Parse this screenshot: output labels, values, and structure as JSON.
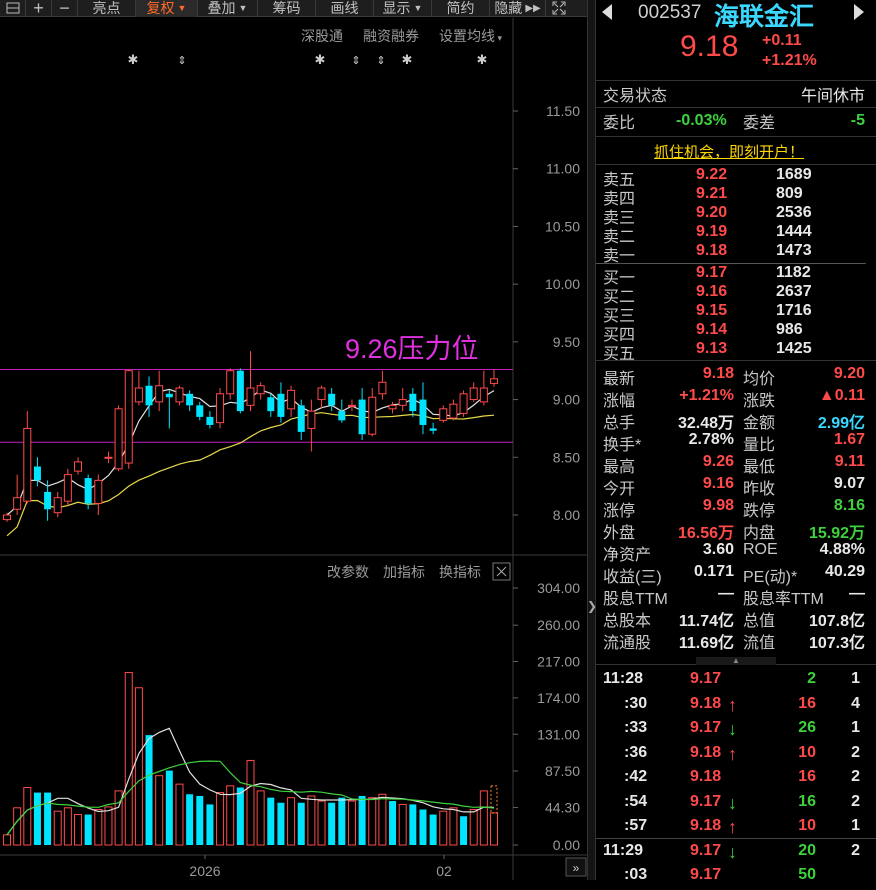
{
  "toolbar": {
    "items": [
      "亮点",
      "复权",
      "叠加",
      "筹码",
      "画线",
      "显示",
      "简约",
      "隐藏"
    ]
  },
  "subbar": {
    "items": [
      "深股通",
      "融资融券",
      "设置均线"
    ]
  },
  "chart": {
    "annotation": "9.26压力位",
    "price_ticks": [
      "11.50",
      "11.00",
      "10.50",
      "10.00",
      "9.50",
      "9.00",
      "8.50",
      "8.00"
    ],
    "volume_ticks": [
      "304.00",
      "260.00",
      "217.00",
      "174.00",
      "131.00",
      "87.50",
      "44.30",
      "0.00"
    ],
    "indicator_buttons": [
      "改参数",
      "加指标",
      "换指标"
    ],
    "x_labels": [
      "2026",
      "02"
    ],
    "colors": {
      "up": "#ff4a4a",
      "down": "#00e5ff",
      "ma_white": "#e0e0e0",
      "ma_yellow": "#e6d84a",
      "ma_green": "#3ed13e",
      "level": "#c020c0",
      "annotation": "#e030e0"
    }
  },
  "chart_data": {
    "type": "candlestick",
    "title": "",
    "resistance": 9.26,
    "support": 8.63,
    "ylim": [
      7.8,
      11.75
    ],
    "volume_ylim": [
      0,
      304
    ],
    "candles": [
      {
        "o": 7.96,
        "c": 8.0,
        "h": 8.02,
        "l": 7.94
      },
      {
        "o": 8.05,
        "c": 8.15,
        "h": 8.35,
        "l": 8.0
      },
      {
        "o": 8.12,
        "c": 8.75,
        "h": 8.9,
        "l": 8.1
      },
      {
        "o": 8.42,
        "c": 8.3,
        "h": 8.5,
        "l": 8.25
      },
      {
        "o": 8.2,
        "c": 8.05,
        "h": 8.3,
        "l": 7.95
      },
      {
        "o": 8.02,
        "c": 8.15,
        "h": 8.2,
        "l": 7.98
      },
      {
        "o": 8.12,
        "c": 8.35,
        "h": 8.4,
        "l": 8.08
      },
      {
        "o": 8.38,
        "c": 8.46,
        "h": 8.5,
        "l": 8.35
      },
      {
        "o": 8.32,
        "c": 8.1,
        "h": 8.35,
        "l": 8.05
      },
      {
        "o": 8.1,
        "c": 8.3,
        "h": 8.35,
        "l": 8.0
      },
      {
        "o": 8.5,
        "c": 8.5,
        "h": 8.55,
        "l": 8.45
      },
      {
        "o": 8.4,
        "c": 8.92,
        "h": 8.95,
        "l": 8.38
      },
      {
        "o": 8.45,
        "c": 9.25,
        "h": 9.26,
        "l": 8.4
      },
      {
        "o": 8.98,
        "c": 9.1,
        "h": 9.25,
        "l": 8.95
      },
      {
        "o": 9.12,
        "c": 8.95,
        "h": 9.2,
        "l": 8.85
      },
      {
        "o": 8.98,
        "c": 9.12,
        "h": 9.25,
        "l": 8.9
      },
      {
        "o": 9.05,
        "c": 9.02,
        "h": 9.08,
        "l": 8.75
      },
      {
        "o": 8.98,
        "c": 9.1,
        "h": 9.12,
        "l": 8.95
      },
      {
        "o": 9.05,
        "c": 8.95,
        "h": 9.08,
        "l": 8.9
      },
      {
        "o": 8.95,
        "c": 8.85,
        "h": 8.98,
        "l": 8.82
      },
      {
        "o": 8.85,
        "c": 8.78,
        "h": 8.9,
        "l": 8.75
      },
      {
        "o": 8.8,
        "c": 9.05,
        "h": 9.1,
        "l": 8.75
      },
      {
        "o": 9.05,
        "c": 9.25,
        "h": 9.27,
        "l": 9.0
      },
      {
        "o": 9.25,
        "c": 8.9,
        "h": 9.27,
        "l": 8.88
      },
      {
        "o": 8.95,
        "c": 9.1,
        "h": 9.42,
        "l": 8.9
      },
      {
        "o": 9.05,
        "c": 9.12,
        "h": 9.15,
        "l": 9.0
      },
      {
        "o": 9.02,
        "c": 8.9,
        "h": 9.05,
        "l": 8.85
      },
      {
        "o": 9.05,
        "c": 8.85,
        "h": 9.15,
        "l": 8.8
      },
      {
        "o": 8.92,
        "c": 9.08,
        "h": 9.12,
        "l": 8.85
      },
      {
        "o": 8.95,
        "c": 8.72,
        "h": 9.0,
        "l": 8.65
      },
      {
        "o": 8.75,
        "c": 8.9,
        "h": 9.0,
        "l": 8.55
      },
      {
        "o": 9.0,
        "c": 9.1,
        "h": 9.12,
        "l": 8.92
      },
      {
        "o": 9.05,
        "c": 8.95,
        "h": 9.1,
        "l": 8.9
      },
      {
        "o": 8.9,
        "c": 8.82,
        "h": 9.0,
        "l": 8.8
      },
      {
        "o": 8.95,
        "c": 8.95,
        "h": 9.0,
        "l": 8.9
      },
      {
        "o": 9.0,
        "c": 8.7,
        "h": 9.1,
        "l": 8.65
      },
      {
        "o": 8.7,
        "c": 9.02,
        "h": 9.1,
        "l": 8.68
      },
      {
        "o": 9.05,
        "c": 9.15,
        "h": 9.25,
        "l": 9.0
      },
      {
        "o": 8.92,
        "c": 8.95,
        "h": 8.98,
        "l": 8.88
      },
      {
        "o": 8.95,
        "c": 9.0,
        "h": 9.1,
        "l": 8.9
      },
      {
        "o": 9.05,
        "c": 8.9,
        "h": 9.1,
        "l": 8.85
      },
      {
        "o": 9.0,
        "c": 8.78,
        "h": 9.15,
        "l": 8.7
      },
      {
        "o": 8.75,
        "c": 8.73,
        "h": 8.8,
        "l": 8.7
      },
      {
        "o": 8.82,
        "c": 8.92,
        "h": 8.95,
        "l": 8.8
      },
      {
        "o": 8.84,
        "c": 8.96,
        "h": 9.0,
        "l": 8.82
      },
      {
        "o": 8.88,
        "c": 9.05,
        "h": 9.08,
        "l": 8.85
      },
      {
        "o": 9.0,
        "c": 9.1,
        "h": 9.15,
        "l": 8.98
      },
      {
        "o": 8.98,
        "c": 9.1,
        "h": 9.25,
        "l": 8.95
      },
      {
        "o": 9.14,
        "c": 9.18,
        "h": 9.26,
        "l": 9.11
      }
    ],
    "volumes": [
      {
        "v": 12,
        "up": true
      },
      {
        "v": 44,
        "up": true
      },
      {
        "v": 68,
        "up": true
      },
      {
        "v": 62,
        "up": false
      },
      {
        "v": 62,
        "up": false
      },
      {
        "v": 40,
        "up": true
      },
      {
        "v": 44,
        "up": true
      },
      {
        "v": 36,
        "up": true
      },
      {
        "v": 36,
        "up": false
      },
      {
        "v": 42,
        "up": true
      },
      {
        "v": 45,
        "up": true
      },
      {
        "v": 64,
        "up": true
      },
      {
        "v": 204,
        "up": true
      },
      {
        "v": 186,
        "up": true
      },
      {
        "v": 130,
        "up": false
      },
      {
        "v": 82,
        "up": true
      },
      {
        "v": 88,
        "up": false
      },
      {
        "v": 72,
        "up": true
      },
      {
        "v": 60,
        "up": false
      },
      {
        "v": 58,
        "up": false
      },
      {
        "v": 48,
        "up": false
      },
      {
        "v": 62,
        "up": true
      },
      {
        "v": 70,
        "up": true
      },
      {
        "v": 68,
        "up": false
      },
      {
        "v": 100,
        "up": true
      },
      {
        "v": 64,
        "up": true
      },
      {
        "v": 56,
        "up": false
      },
      {
        "v": 50,
        "up": false
      },
      {
        "v": 56,
        "up": true
      },
      {
        "v": 50,
        "up": false
      },
      {
        "v": 58,
        "up": true
      },
      {
        "v": 52,
        "up": true
      },
      {
        "v": 50,
        "up": false
      },
      {
        "v": 56,
        "up": false
      },
      {
        "v": 52,
        "up": true
      },
      {
        "v": 58,
        "up": false
      },
      {
        "v": 56,
        "up": true
      },
      {
        "v": 60,
        "up": true
      },
      {
        "v": 52,
        "up": false
      },
      {
        "v": 48,
        "up": true
      },
      {
        "v": 48,
        "up": false
      },
      {
        "v": 42,
        "up": false
      },
      {
        "v": 36,
        "up": false
      },
      {
        "v": 40,
        "up": true
      },
      {
        "v": 44,
        "up": true
      },
      {
        "v": 34,
        "up": false
      },
      {
        "v": 42,
        "up": true
      },
      {
        "v": 64,
        "up": true
      },
      {
        "v": 38,
        "up": true
      }
    ]
  },
  "quote": {
    "code": "002537",
    "name": "海联金汇",
    "price": "9.18",
    "change": "+0.11",
    "change_pct": "+1.21%",
    "status_label": "交易状态",
    "status_value": "午间休市",
    "ratio_label": "委比",
    "ratio_value": "-0.03%",
    "diff_label": "委差",
    "diff_value": "-5",
    "promo": "抓住机会，即刻开户！",
    "asks": [
      {
        "label": "卖五",
        "price": "9.22",
        "vol": "1689"
      },
      {
        "label": "卖四",
        "price": "9.21",
        "vol": "809"
      },
      {
        "label": "卖三",
        "price": "9.20",
        "vol": "2536"
      },
      {
        "label": "卖二",
        "price": "9.19",
        "vol": "1444"
      },
      {
        "label": "卖一",
        "price": "9.18",
        "vol": "1473"
      }
    ],
    "bids": [
      {
        "label": "买一",
        "price": "9.17",
        "vol": "1182"
      },
      {
        "label": "买二",
        "price": "9.16",
        "vol": "2637"
      },
      {
        "label": "买三",
        "price": "9.15",
        "vol": "1716"
      },
      {
        "label": "买四",
        "price": "9.14",
        "vol": "986"
      },
      {
        "label": "买五",
        "price": "9.13",
        "vol": "1425"
      }
    ],
    "stats": [
      {
        "l1": "最新",
        "v1": "9.18",
        "c1": "red",
        "l2": "均价",
        "v2": "9.20",
        "c2": "red"
      },
      {
        "l1": "涨幅",
        "v1": "+1.21%",
        "c1": "red",
        "l2": "涨跌",
        "v2": "▲0.11",
        "c2": "red"
      },
      {
        "l1": "总手",
        "v1": "32.48万",
        "c1": "white",
        "l2": "金额",
        "v2": "2.99亿",
        "c2": "cyan"
      },
      {
        "l1": "换手*",
        "v1": "2.78%",
        "c1": "white",
        "l2": "量比",
        "v2": "1.67",
        "c2": "red"
      },
      {
        "l1": "最高",
        "v1": "9.26",
        "c1": "red",
        "l2": "最低",
        "v2": "9.11",
        "c2": "red"
      },
      {
        "l1": "今开",
        "v1": "9.16",
        "c1": "red",
        "l2": "昨收",
        "v2": "9.07",
        "c2": "white"
      },
      {
        "l1": "涨停",
        "v1": "9.98",
        "c1": "red",
        "l2": "跌停",
        "v2": "8.16",
        "c2": "green"
      },
      {
        "l1": "外盘",
        "v1": "16.56万",
        "c1": "red",
        "l2": "内盘",
        "v2": "15.92万",
        "c2": "green"
      },
      {
        "l1": "净资产",
        "v1": "3.60",
        "c1": "white",
        "l2": "ROE",
        "v2": "4.88%",
        "c2": "white"
      },
      {
        "l1": "收益(三)",
        "v1": "0.171",
        "c1": "white",
        "l2": "PE(动)*",
        "v2": "40.29",
        "c2": "white"
      },
      {
        "l1": "股息TTM",
        "v1": "—",
        "c1": "white",
        "l2": "股息率TTM",
        "v2": "—",
        "c2": "white"
      },
      {
        "l1": "总股本",
        "v1": "11.74亿",
        "c1": "white",
        "l2": "总值",
        "v2": "107.8亿",
        "c2": "white"
      },
      {
        "l1": "流通股",
        "v1": "11.69亿",
        "c1": "white",
        "l2": "流值",
        "v2": "107.3亿",
        "c2": "white"
      }
    ],
    "ticks": [
      {
        "time": "11:28",
        "price": "9.17",
        "arrow": "",
        "pc": "red",
        "vol": "2",
        "vc": "green",
        "n": "1"
      },
      {
        "time": ":30",
        "price": "9.18",
        "arrow": "↑",
        "pc": "red",
        "vol": "16",
        "vc": "red",
        "n": "4"
      },
      {
        "time": ":33",
        "price": "9.17",
        "arrow": "↓",
        "pc": "red",
        "vol": "26",
        "vc": "green",
        "n": "1"
      },
      {
        "time": ":36",
        "price": "9.18",
        "arrow": "↑",
        "pc": "red",
        "vol": "10",
        "vc": "red",
        "n": "2"
      },
      {
        "time": ":42",
        "price": "9.18",
        "arrow": "",
        "pc": "red",
        "vol": "16",
        "vc": "red",
        "n": "2"
      },
      {
        "time": ":54",
        "price": "9.17",
        "arrow": "↓",
        "pc": "red",
        "vol": "16",
        "vc": "green",
        "n": "2"
      },
      {
        "time": ":57",
        "price": "9.18",
        "arrow": "↑",
        "pc": "red",
        "vol": "10",
        "vc": "red",
        "n": "1"
      },
      {
        "time": "11:29",
        "price": "9.17",
        "arrow": "↓",
        "pc": "red",
        "vol": "20",
        "vc": "green",
        "n": "2"
      },
      {
        "time": ":03",
        "price": "9.17",
        "arrow": "",
        "pc": "red",
        "vol": "50",
        "vc": "green",
        "n": ""
      }
    ]
  }
}
